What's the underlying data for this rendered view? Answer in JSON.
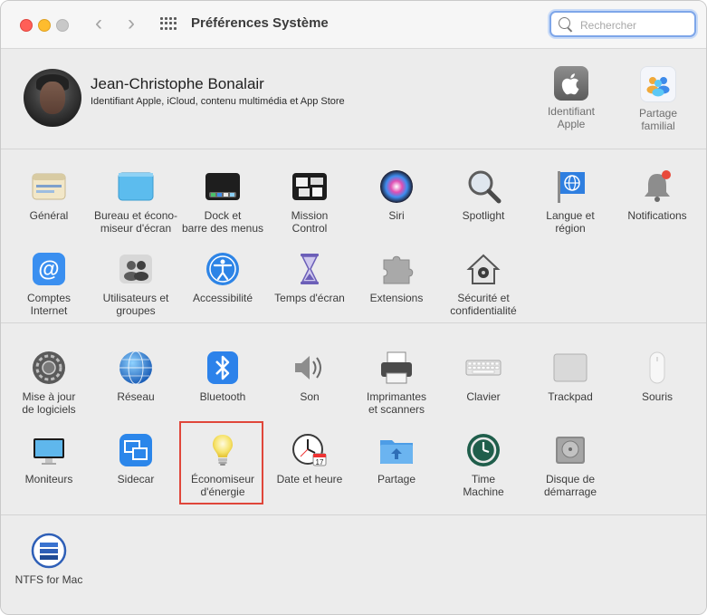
{
  "window": {
    "title": "Préférences Système",
    "search": {
      "placeholder": "Rechercher",
      "value": ""
    }
  },
  "account": {
    "name": "Jean-Christophe Bonalair",
    "subtitle": "Identifiant Apple, iCloud, contenu multimédia et App Store",
    "apple_id": [
      "Identifiant",
      "Apple"
    ],
    "family": [
      "Partage",
      "familial"
    ]
  },
  "section1": [
    {
      "id": "general",
      "label": [
        "Général"
      ],
      "icon": "general-icon"
    },
    {
      "id": "desktop",
      "label": [
        "Bureau et écono-",
        "miseur d'écran"
      ],
      "icon": "desktop-icon"
    },
    {
      "id": "dock",
      "label": [
        "Dock et",
        "barre des menus"
      ],
      "icon": "dock-icon"
    },
    {
      "id": "mission",
      "label": [
        "Mission",
        "Control"
      ],
      "icon": "mission-control-icon"
    },
    {
      "id": "siri",
      "label": [
        "Siri"
      ],
      "icon": "siri-icon"
    },
    {
      "id": "spotlight",
      "label": [
        "Spotlight"
      ],
      "icon": "spotlight-icon"
    },
    {
      "id": "language",
      "label": [
        "Langue et",
        "région"
      ],
      "icon": "globe-flag-icon"
    },
    {
      "id": "notifications",
      "label": [
        "Notifications"
      ],
      "icon": "bell-icon"
    },
    {
      "id": "internet",
      "label": [
        "Comptes",
        "Internet"
      ],
      "icon": "at-icon"
    },
    {
      "id": "users",
      "label": [
        "Utilisateurs et",
        "groupes"
      ],
      "icon": "users-icon"
    },
    {
      "id": "accessibility",
      "label": [
        "Accessibilité"
      ],
      "icon": "accessibility-icon"
    },
    {
      "id": "screentime",
      "label": [
        "Temps d'écran"
      ],
      "icon": "hourglass-icon"
    },
    {
      "id": "extensions",
      "label": [
        "Extensions"
      ],
      "icon": "puzzle-icon"
    },
    {
      "id": "security",
      "label": [
        "Sécurité et",
        "confidentialité"
      ],
      "icon": "house-lock-icon"
    }
  ],
  "section2": [
    {
      "id": "update",
      "label": [
        "Mise à jour",
        "de logiciels"
      ],
      "icon": "gear-update-icon"
    },
    {
      "id": "network",
      "label": [
        "Réseau"
      ],
      "icon": "network-globe-icon"
    },
    {
      "id": "bluetooth",
      "label": [
        "Bluetooth"
      ],
      "icon": "bluetooth-icon"
    },
    {
      "id": "sound",
      "label": [
        "Son"
      ],
      "icon": "speaker-icon"
    },
    {
      "id": "printers",
      "label": [
        "Imprimantes",
        "et scanners"
      ],
      "icon": "printer-icon"
    },
    {
      "id": "keyboard",
      "label": [
        "Clavier"
      ],
      "icon": "keyboard-icon"
    },
    {
      "id": "trackpad",
      "label": [
        "Trackpad"
      ],
      "icon": "trackpad-icon"
    },
    {
      "id": "mouse",
      "label": [
        "Souris"
      ],
      "icon": "mouse-icon"
    },
    {
      "id": "displays",
      "label": [
        "Moniteurs"
      ],
      "icon": "display-icon"
    },
    {
      "id": "sidecar",
      "label": [
        "Sidecar"
      ],
      "icon": "sidecar-icon"
    },
    {
      "id": "energy",
      "label": [
        "Économiseur",
        "d'énergie"
      ],
      "icon": "lightbulb-icon"
    },
    {
      "id": "datetime",
      "label": [
        "Date et heure"
      ],
      "icon": "clock-calendar-icon"
    },
    {
      "id": "sharing",
      "label": [
        "Partage"
      ],
      "icon": "sharing-folder-icon"
    },
    {
      "id": "timemachine",
      "label": [
        "Time",
        "Machine"
      ],
      "icon": "time-machine-icon"
    },
    {
      "id": "startup",
      "label": [
        "Disque de",
        "démarrage"
      ],
      "icon": "disk-icon"
    }
  ],
  "section3": [
    {
      "id": "ntfs",
      "label": [
        "NTFS for Mac"
      ],
      "icon": "ntfs-icon"
    }
  ],
  "colors": {
    "highlight": "#e0463a",
    "search_focus": "#7ea6e9"
  }
}
